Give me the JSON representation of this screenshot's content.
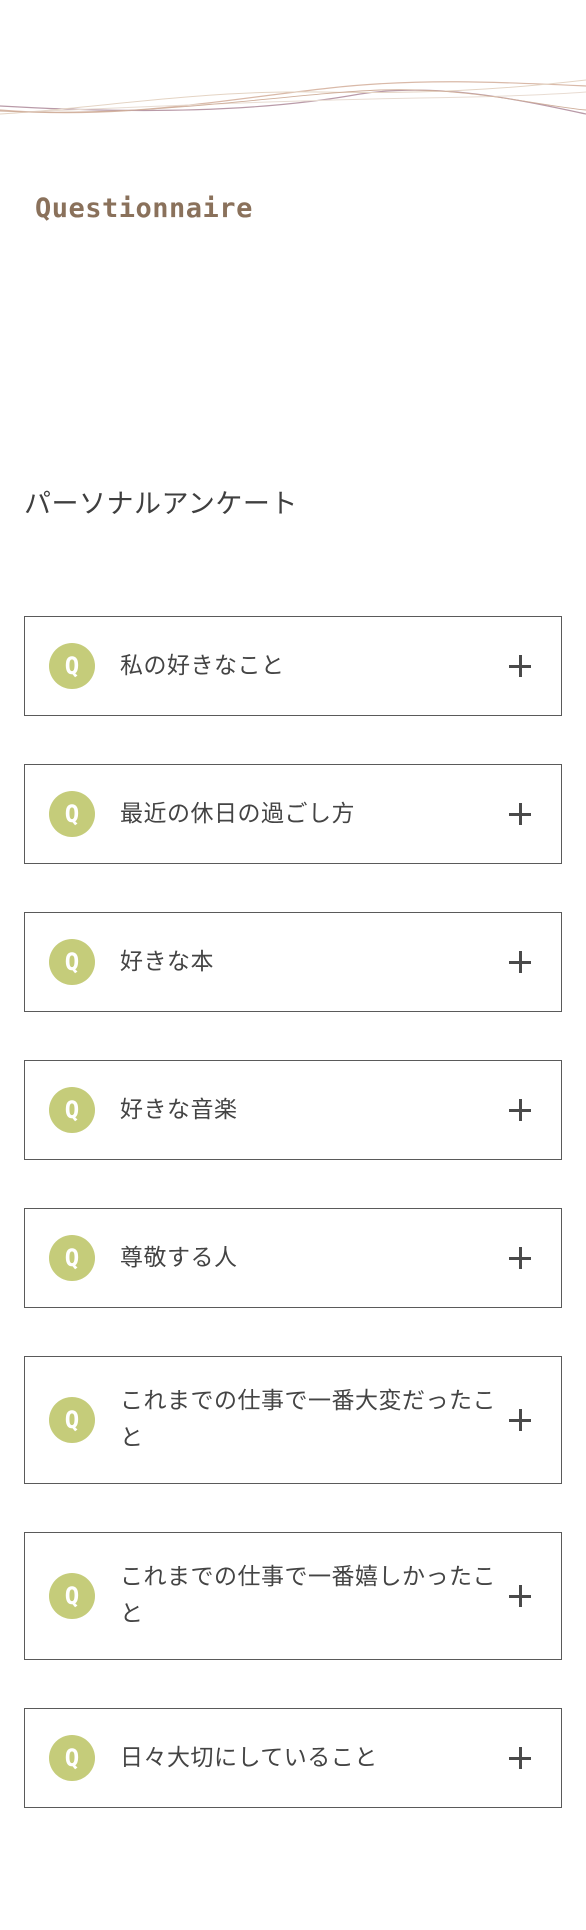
{
  "header": {
    "section_label": "Questionnaire",
    "wave_colors": [
      "#c9a99a",
      "#b99aa8",
      "#d8c4a8",
      "#e2d2c6"
    ]
  },
  "main": {
    "title": "パーソナルアンケート",
    "badge_label": "Q",
    "badge_color": "#c5cc7a",
    "expand_icon": "plus-icon",
    "questions": [
      {
        "text": "私の好きなこと"
      },
      {
        "text": "最近の休日の過ごし方"
      },
      {
        "text": "好きな本"
      },
      {
        "text": "好きな音楽"
      },
      {
        "text": "尊敬する人"
      },
      {
        "text": "これまでの仕事で一番大変だったこと"
      },
      {
        "text": "これまでの仕事で一番嬉しかったこと"
      },
      {
        "text": "日々大切にしていること"
      }
    ]
  }
}
